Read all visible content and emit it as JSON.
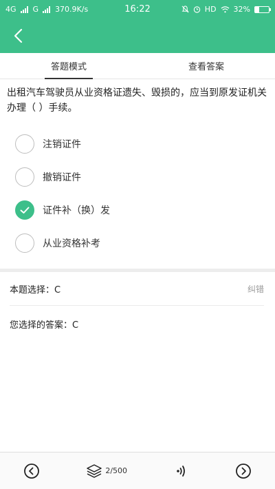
{
  "status_bar": {
    "network": "4G",
    "signal_text": "G",
    "speed": "370.9K/s",
    "time": "16:22",
    "hd": "HD",
    "battery": "32%",
    "battery_level": 0.32
  },
  "tabs": [
    {
      "label": "答题模式",
      "active": true
    },
    {
      "label": "查看答案",
      "active": false
    }
  ],
  "question": {
    "text": "出租汽车驾驶员从业资格证遗失、毁损的，应当到原发证机关办理（ ）手续。"
  },
  "options": [
    {
      "label": "注销证件",
      "selected": false
    },
    {
      "label": "撤销证件",
      "selected": false
    },
    {
      "label": "证件补（换）发",
      "selected": true
    },
    {
      "label": "从业资格补考",
      "selected": false
    }
  ],
  "result": {
    "this_question": "本题选择：C",
    "report_error": "纠错",
    "your_answer": "您选择的答案：C"
  },
  "bottom_nav": {
    "page_counter": "2/500"
  },
  "colors": {
    "accent": "#3dbf8a"
  }
}
